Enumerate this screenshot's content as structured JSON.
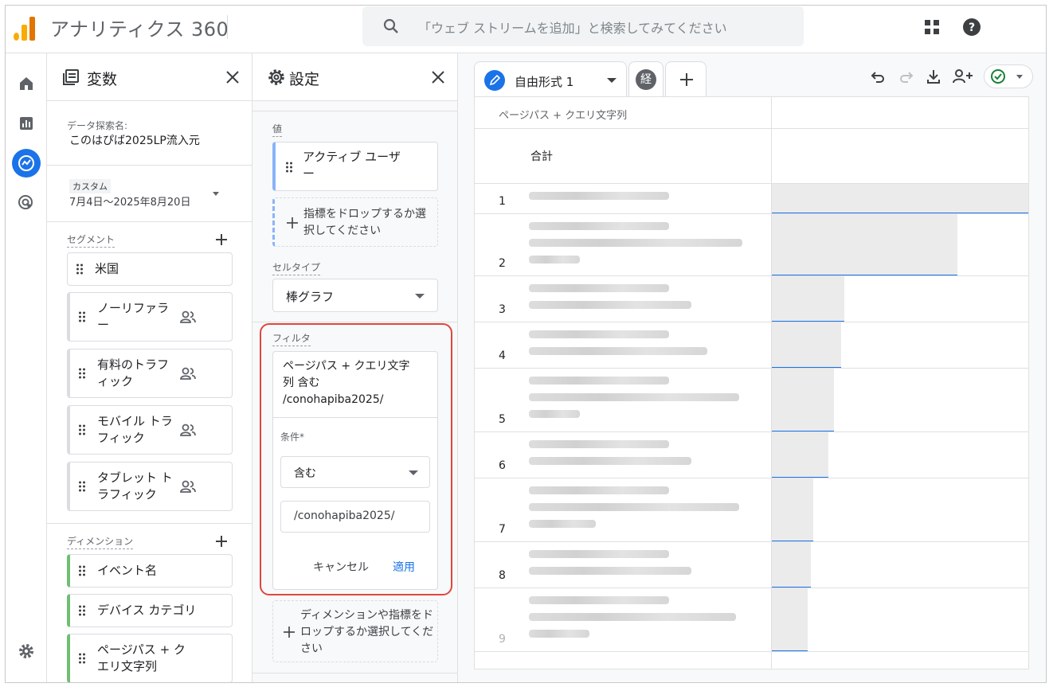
{
  "header": {
    "app_title": "アナリティクス 360",
    "search_placeholder": "「ウェブ ストリームを追加」と検索してみてください"
  },
  "rail": {
    "items": [
      "home-icon",
      "reports-icon",
      "explore-icon",
      "advertising-icon",
      "gear-icon"
    ],
    "active": "explore-icon"
  },
  "variables": {
    "title": "変数",
    "exploration_name_label": "データ探索名:",
    "exploration_name": "このはぴば2025LP流入元",
    "date_badge": "カスタム",
    "date_range": "7月4日〜2025年8月20日",
    "segments_label": "セグメント",
    "segments": [
      "米国",
      "ノーリファラー",
      "有料のトラフィック",
      "モバイル トラフィック",
      "タブレット トラフィック"
    ],
    "dimensions_label": "ディメンション",
    "dimensions": [
      "イベント名",
      "デバイス カテゴリ",
      "ページパス + クエリ文字列"
    ]
  },
  "settings": {
    "title": "設定",
    "values_label": "値",
    "value_metric": "アクティブ ユーザー",
    "drop_metric": "指標をドロップするか選択してください",
    "cell_type_label": "セルタイプ",
    "cell_type": "棒グラフ",
    "filters_label": "フィルタ",
    "filter_summary": "ページパス + クエリ文字列 含む /conohapiba2025/",
    "condition_label": "条件*",
    "condition_value": "含む",
    "filter_expression": "/conohapiba2025/",
    "cancel": "キャンセル",
    "apply": "適用",
    "drop_filter": "ディメンションや指標をドロップするか選択してください"
  },
  "canvas": {
    "tab_label": "自由形式 1",
    "tab2_glyph": "経",
    "column_header": "ページパス + クエリ文字列",
    "total_label": "合計",
    "rows": [
      {
        "n": "1",
        "bar": 1.0
      },
      {
        "n": "2",
        "bar": 0.72
      },
      {
        "n": "3",
        "bar": 0.28
      },
      {
        "n": "4",
        "bar": 0.27
      },
      {
        "n": "5",
        "bar": 0.24
      },
      {
        "n": "6",
        "bar": 0.22
      },
      {
        "n": "7",
        "bar": 0.16
      },
      {
        "n": "8",
        "bar": 0.15
      },
      {
        "n": "9",
        "bar": 0.14
      }
    ]
  },
  "colors": {
    "accent": "#1a73e8",
    "filter_highlight": "#e0463e",
    "dimension_chip": "#6fbf73",
    "logo": "#f9ab00"
  }
}
